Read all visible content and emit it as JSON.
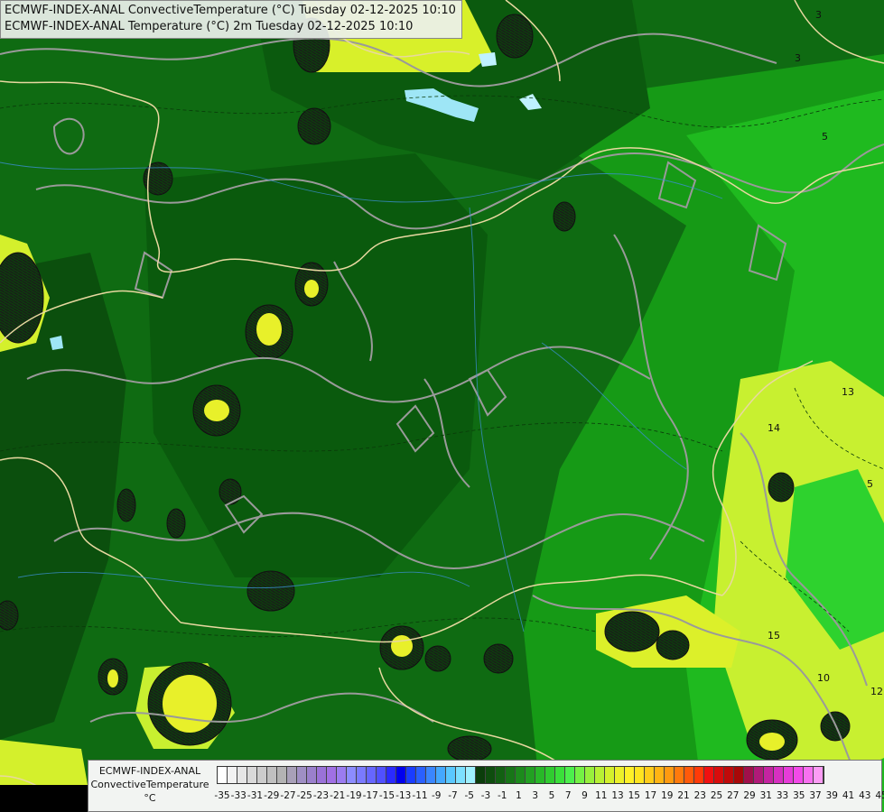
{
  "header": {
    "line1": "ECMWF-INDEX-ANAL ConvectiveTemperature (°C) Tuesday 02-12-2025 10:10",
    "line2": "ECMWF-INDEX-ANAL Temperature (°C) 2m Tuesday 02-12-2025 10:10"
  },
  "legend": {
    "model": "ECMWF-INDEX-ANAL",
    "param": "ConvectiveTemperature",
    "unit": "°C",
    "tick_labels": [
      "-35",
      "-33",
      "-31",
      "-29",
      "-27",
      "-25",
      "-23",
      "-21",
      "-19",
      "-17",
      "-15",
      "-13",
      "-11",
      "-9",
      "-7",
      "-5",
      "-3",
      "-1",
      "1",
      "3",
      "5",
      "7",
      "9",
      "11",
      "13",
      "15",
      "17",
      "19",
      "21",
      "23",
      "25",
      "27",
      "29",
      "31",
      "33",
      "35",
      "37",
      "39",
      "41",
      "43",
      "45"
    ],
    "colors": [
      "#ffffff",
      "#f2f2f2",
      "#e6e6e6",
      "#d9d9d9",
      "#cccccc",
      "#c0c0c0",
      "#b3b3b3",
      "#a8a0b8",
      "#9f8fc4",
      "#9a80cc",
      "#9a72d8",
      "#a070e4",
      "#9b7cf0",
      "#8c8cff",
      "#7a7aff",
      "#6666ff",
      "#5050ff",
      "#2a2aff",
      "#0000ee",
      "#1a3cff",
      "#2a60ff",
      "#3a86ff",
      "#44a8ff",
      "#5ac8ff",
      "#7de0ff",
      "#9ff0ff",
      "#0b3d0b",
      "#0e4d0e",
      "#126012",
      "#177517",
      "#1c8a1c",
      "#22a022",
      "#28b828",
      "#30cc30",
      "#3ae03a",
      "#4cf04c",
      "#74f244",
      "#98f03c",
      "#b8f034",
      "#d4f02c",
      "#ecf02a",
      "#fff028",
      "#ffe420",
      "#ffcc1a",
      "#ffb414",
      "#ff9a10",
      "#ff7a0c",
      "#ff5a0a",
      "#ff3a08",
      "#f01010",
      "#d80c0c",
      "#c00a0a",
      "#a80808",
      "#a0104a",
      "#b01a78",
      "#c424a0",
      "#d630c0",
      "#e63cd8",
      "#f24ae8",
      "#f870f0",
      "#fc9cf4"
    ]
  },
  "map": {
    "contour_labels": [
      {
        "text": "3"
      },
      {
        "text": "5"
      },
      {
        "text": "13"
      },
      {
        "text": "14"
      },
      {
        "text": "15"
      },
      {
        "text": "10"
      },
      {
        "text": "5"
      },
      {
        "text": "12"
      },
      {
        "text": "3"
      }
    ]
  }
}
